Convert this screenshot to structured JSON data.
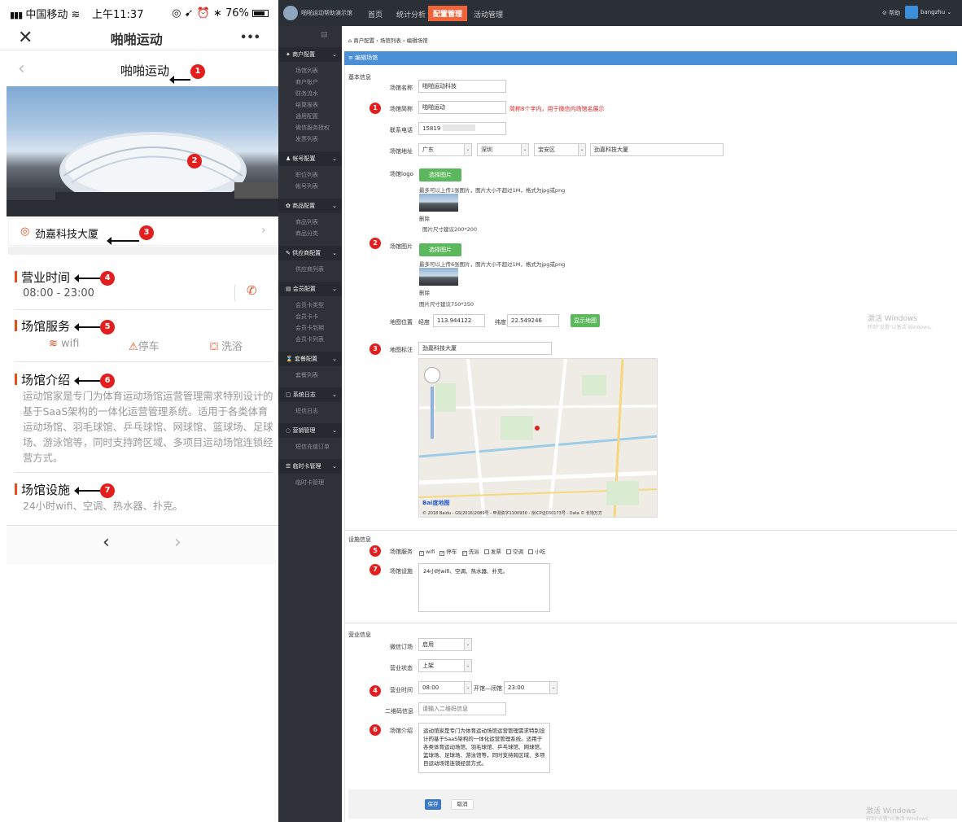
{
  "phone": {
    "status": {
      "carrier": "中国移动",
      "time": "上午11:37",
      "battery": "76%"
    },
    "header": {
      "title": "啪啪运动",
      "menu": "•••"
    },
    "page": {
      "title": "啪啪运动"
    },
    "location": "劲嘉科技大厦",
    "hours": {
      "title": "营业时间",
      "value": "08:00 - 23:00"
    },
    "services": {
      "title": "场馆服务",
      "items": [
        "wifi",
        "停车",
        "洗浴"
      ]
    },
    "intro": {
      "title": "场馆介绍",
      "text": "运动馆家是专门为体育运动场馆运营管理需求特别设计的基于SaaS架构的一体化运营管理系统。适用于各类体育运动场馆、羽毛球馆、乒乓球馆、网球馆、篮球场、足球场、游泳馆等，同时支持跨区域、多项目运动场馆连锁经营方式。"
    },
    "facilities": {
      "title": "场馆设施",
      "text": "24小时wifi、空调、热水器、扑克。"
    },
    "badges": [
      "1",
      "2",
      "3",
      "4",
      "5",
      "6",
      "7"
    ]
  },
  "admin": {
    "brand": "啪啪运动帮助演示馆",
    "nav": [
      "首页",
      "统计分析",
      "配置管理",
      "活动管理"
    ],
    "help": "帮助",
    "user": "bangzhu",
    "sidebar": [
      {
        "group": "商户配置",
        "items": [
          "场馆列表",
          "商户账户",
          "财务流水",
          "结算报表",
          "通用配置",
          "微信服务授权",
          "发票列表"
        ]
      },
      {
        "group": "帐号配置",
        "items": [
          "职位列表",
          "帐号列表"
        ]
      },
      {
        "group": "商品配置",
        "items": [
          "商品列表",
          "商品分类"
        ]
      },
      {
        "group": "供应商配置",
        "items": [
          "供应商列表"
        ]
      },
      {
        "group": "会员配置",
        "items": [
          "会员卡类型",
          "会员卡卡",
          "会员卡到期",
          "会员卡列表"
        ]
      },
      {
        "group": "套餐配置",
        "items": [
          "套餐列表"
        ]
      },
      {
        "group": "系统日志",
        "items": [
          "短信日志"
        ]
      },
      {
        "group": "营销管理",
        "items": [
          "短信充值订单"
        ]
      },
      {
        "group": "临时卡管理",
        "items": [
          "临时卡管理"
        ]
      }
    ],
    "breadcrumb": "商户配置 › 场馆列表 › 编辑场馆",
    "panel_title": "编辑场馆",
    "basic": "基本信息",
    "f_name": "场馆名称",
    "v_name": "啪啪运动科技",
    "f_short": "场馆简称",
    "v_short": "啪啪运动",
    "hint_short": "简称8个字内，用于微信内场馆名展示",
    "f_phone": "联系电话",
    "v_phone": "15819",
    "f_addr": "场馆地址",
    "v_prov": "广东",
    "v_city": "深圳",
    "v_dist": "宝安区",
    "v_addr": "劲嘉科技大厦",
    "f_logo": "场馆logo",
    "btn_choose": "选择图片",
    "logo_hint": "最多可以上传1张图片，图片大小不超过1M，格式为jpg或png",
    "del": "删除",
    "logo_size": "图片尺寸建议200*200",
    "f_img": "场馆图片",
    "img_hint": "最多可以上传6张图片，图片大小不超过1M，格式为jpg或png",
    "img_size": "图片尺寸建议750*350",
    "f_map": "地图位置",
    "lng_l": "经度",
    "lng": "113.944122",
    "lat_l": "纬度",
    "lat": "22.549246",
    "btn_map": "显示地图",
    "f_mark": "地图标注",
    "v_mark": "劲嘉科技大厦",
    "map_copy": "© 2018 Baidu - GS(2016)2089号 - 甲测资字1100930 - 京ICP证030173号 - Data © 长地万方",
    "map_logo": "Bai度地图",
    "fac": "设施信息",
    "f_service": "场馆服务",
    "svc": [
      "wifi",
      "停车",
      "洗浴",
      "发票",
      "空调",
      "小吃"
    ],
    "f_fac": "场馆设施",
    "v_fac": "24小时wifi、空调、热水器、扑克。",
    "biz": "营业信息",
    "f_wx": "微信订场",
    "v_wx": "启用",
    "f_state": "营业状态",
    "v_state": "上架",
    "f_time": "营业时间",
    "v_open": "08:00",
    "open_sep": "开馆—闭馆",
    "v_close": "23:00",
    "f_qr": "二维码信息",
    "ph_qr": "请输入二维码信息",
    "f_intro": "场馆介绍",
    "v_intro": "运动馆家是专门为体育运动场馆运营管理需求特别设计的基于SaaS架构的一体化运营管理系统。适用于各类体育运动场馆、羽毛球馆、乒乓球馆、网球馆、篮球场、足球场、游泳馆等，同时支持跨区域、多项目运动场馆连锁经营方式。",
    "btn_save": "保存",
    "btn_cancel": "取消",
    "wm1": "激活 Windows",
    "wm2": "转到\"设置\"以激活 Windows。"
  }
}
